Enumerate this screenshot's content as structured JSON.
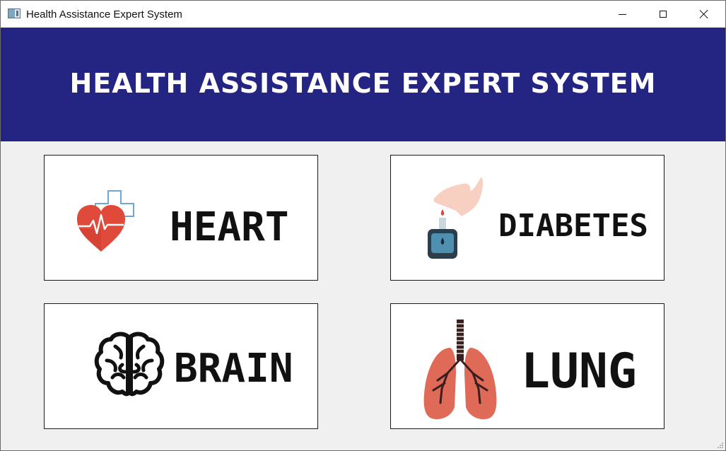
{
  "window": {
    "title": "Health Assistance Expert System",
    "controls": {
      "minimize": "minimize-icon",
      "maximize": "maximize-icon",
      "close": "close-icon"
    }
  },
  "banner": {
    "title": "HEALTH ASSISTANCE EXPERT SYSTEM",
    "background": "#242582",
    "color": "#ffffff"
  },
  "cards": [
    {
      "id": "heart",
      "label": "HEART",
      "icon": "heart-cross-icon"
    },
    {
      "id": "diabetes",
      "label": "DIABETES",
      "icon": "glucose-meter-icon"
    },
    {
      "id": "brain",
      "label": "BRAIN",
      "icon": "brain-icon"
    },
    {
      "id": "lung",
      "label": "LUNG",
      "icon": "lungs-icon"
    }
  ],
  "colors": {
    "window_background": "#f0f0f0",
    "card_background": "#ffffff",
    "heart_red": "#e04a3b",
    "lung_red": "#e06a58"
  }
}
